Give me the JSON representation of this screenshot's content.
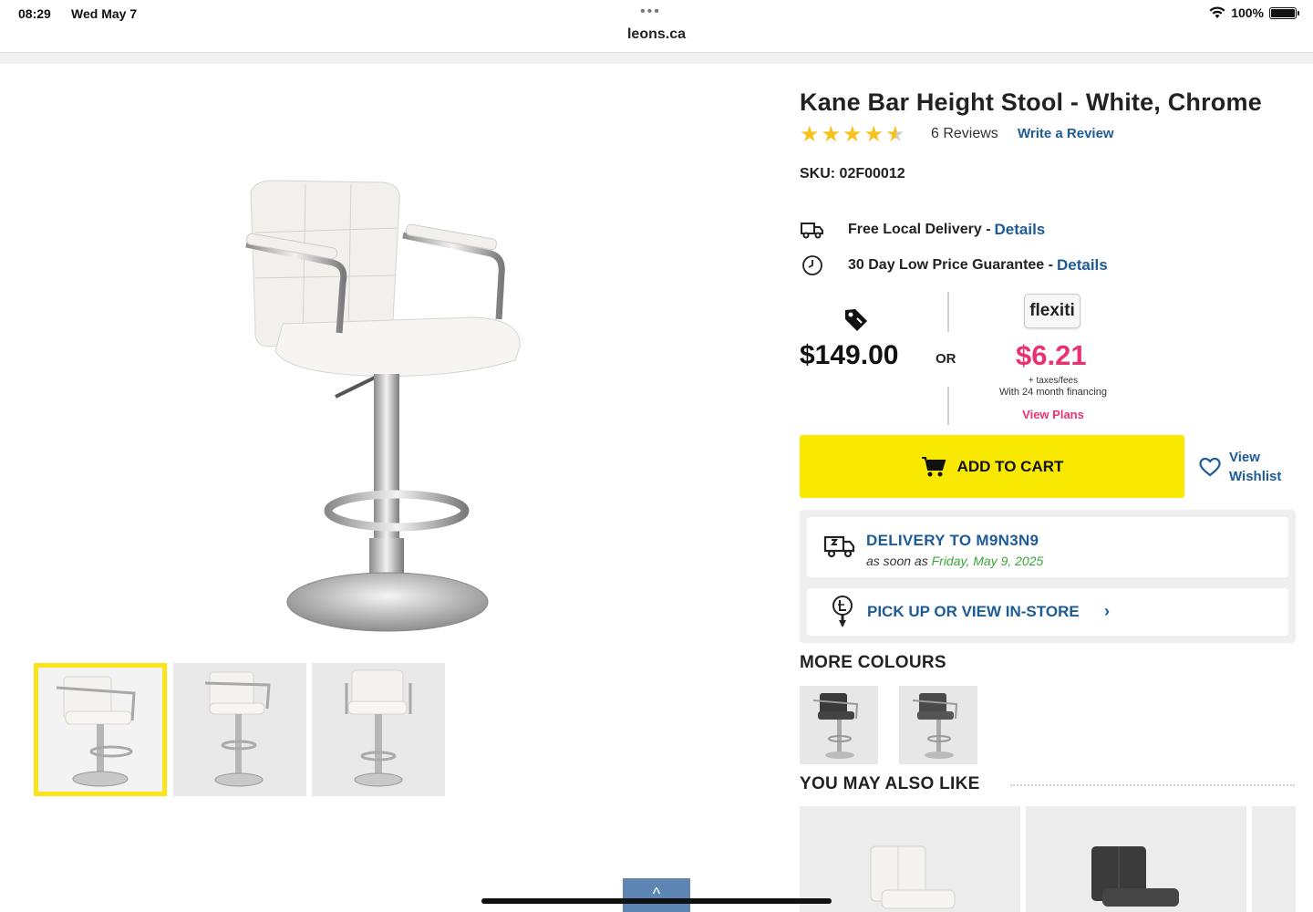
{
  "status_bar": {
    "time": "08:29",
    "date": "Wed May 7",
    "url": "leons.ca",
    "battery": "100%",
    "dots": "•••"
  },
  "product": {
    "title": "Kane Bar Height Stool - White, Chrome",
    "rating": 4.5,
    "reviews": "6 Reviews",
    "write_review": "Write a Review",
    "sku": "SKU: 02F00012"
  },
  "features": [
    {
      "label": "Free Local Delivery - ",
      "link": "Details",
      "icon": "delivery-truck-icon"
    },
    {
      "label": "30 Day Low Price Guarantee - ",
      "link": "Details",
      "icon": "clock-icon"
    }
  ],
  "pricing": {
    "price": "$149.00",
    "or": "OR",
    "flexiti_logo": "flexiti",
    "financing_amount": "$6.21",
    "financing_note1": "+ taxes/fees",
    "financing_note2": "With 24 month financing",
    "view_plans": "View Plans"
  },
  "actions": {
    "add_to_cart": "ADD TO CART",
    "view_wishlist_1": "View",
    "view_wishlist_2": "Wishlist"
  },
  "delivery": {
    "title": "DELIVERY TO M9N3N9",
    "sub_prefix": "as soon as ",
    "date": "Friday, May 9, 2025",
    "pickup": "PICK UP OR VIEW IN-STORE",
    "chevron": "›"
  },
  "more_colours": {
    "heading": "MORE COLOURS"
  },
  "also_like": {
    "heading": "YOU MAY ALSO LIKE"
  },
  "scroll_top": "^",
  "colors": {
    "accent": "#f9e800",
    "link": "#1d5b96",
    "finance": "#e8336f",
    "green": "#3aa63a"
  }
}
